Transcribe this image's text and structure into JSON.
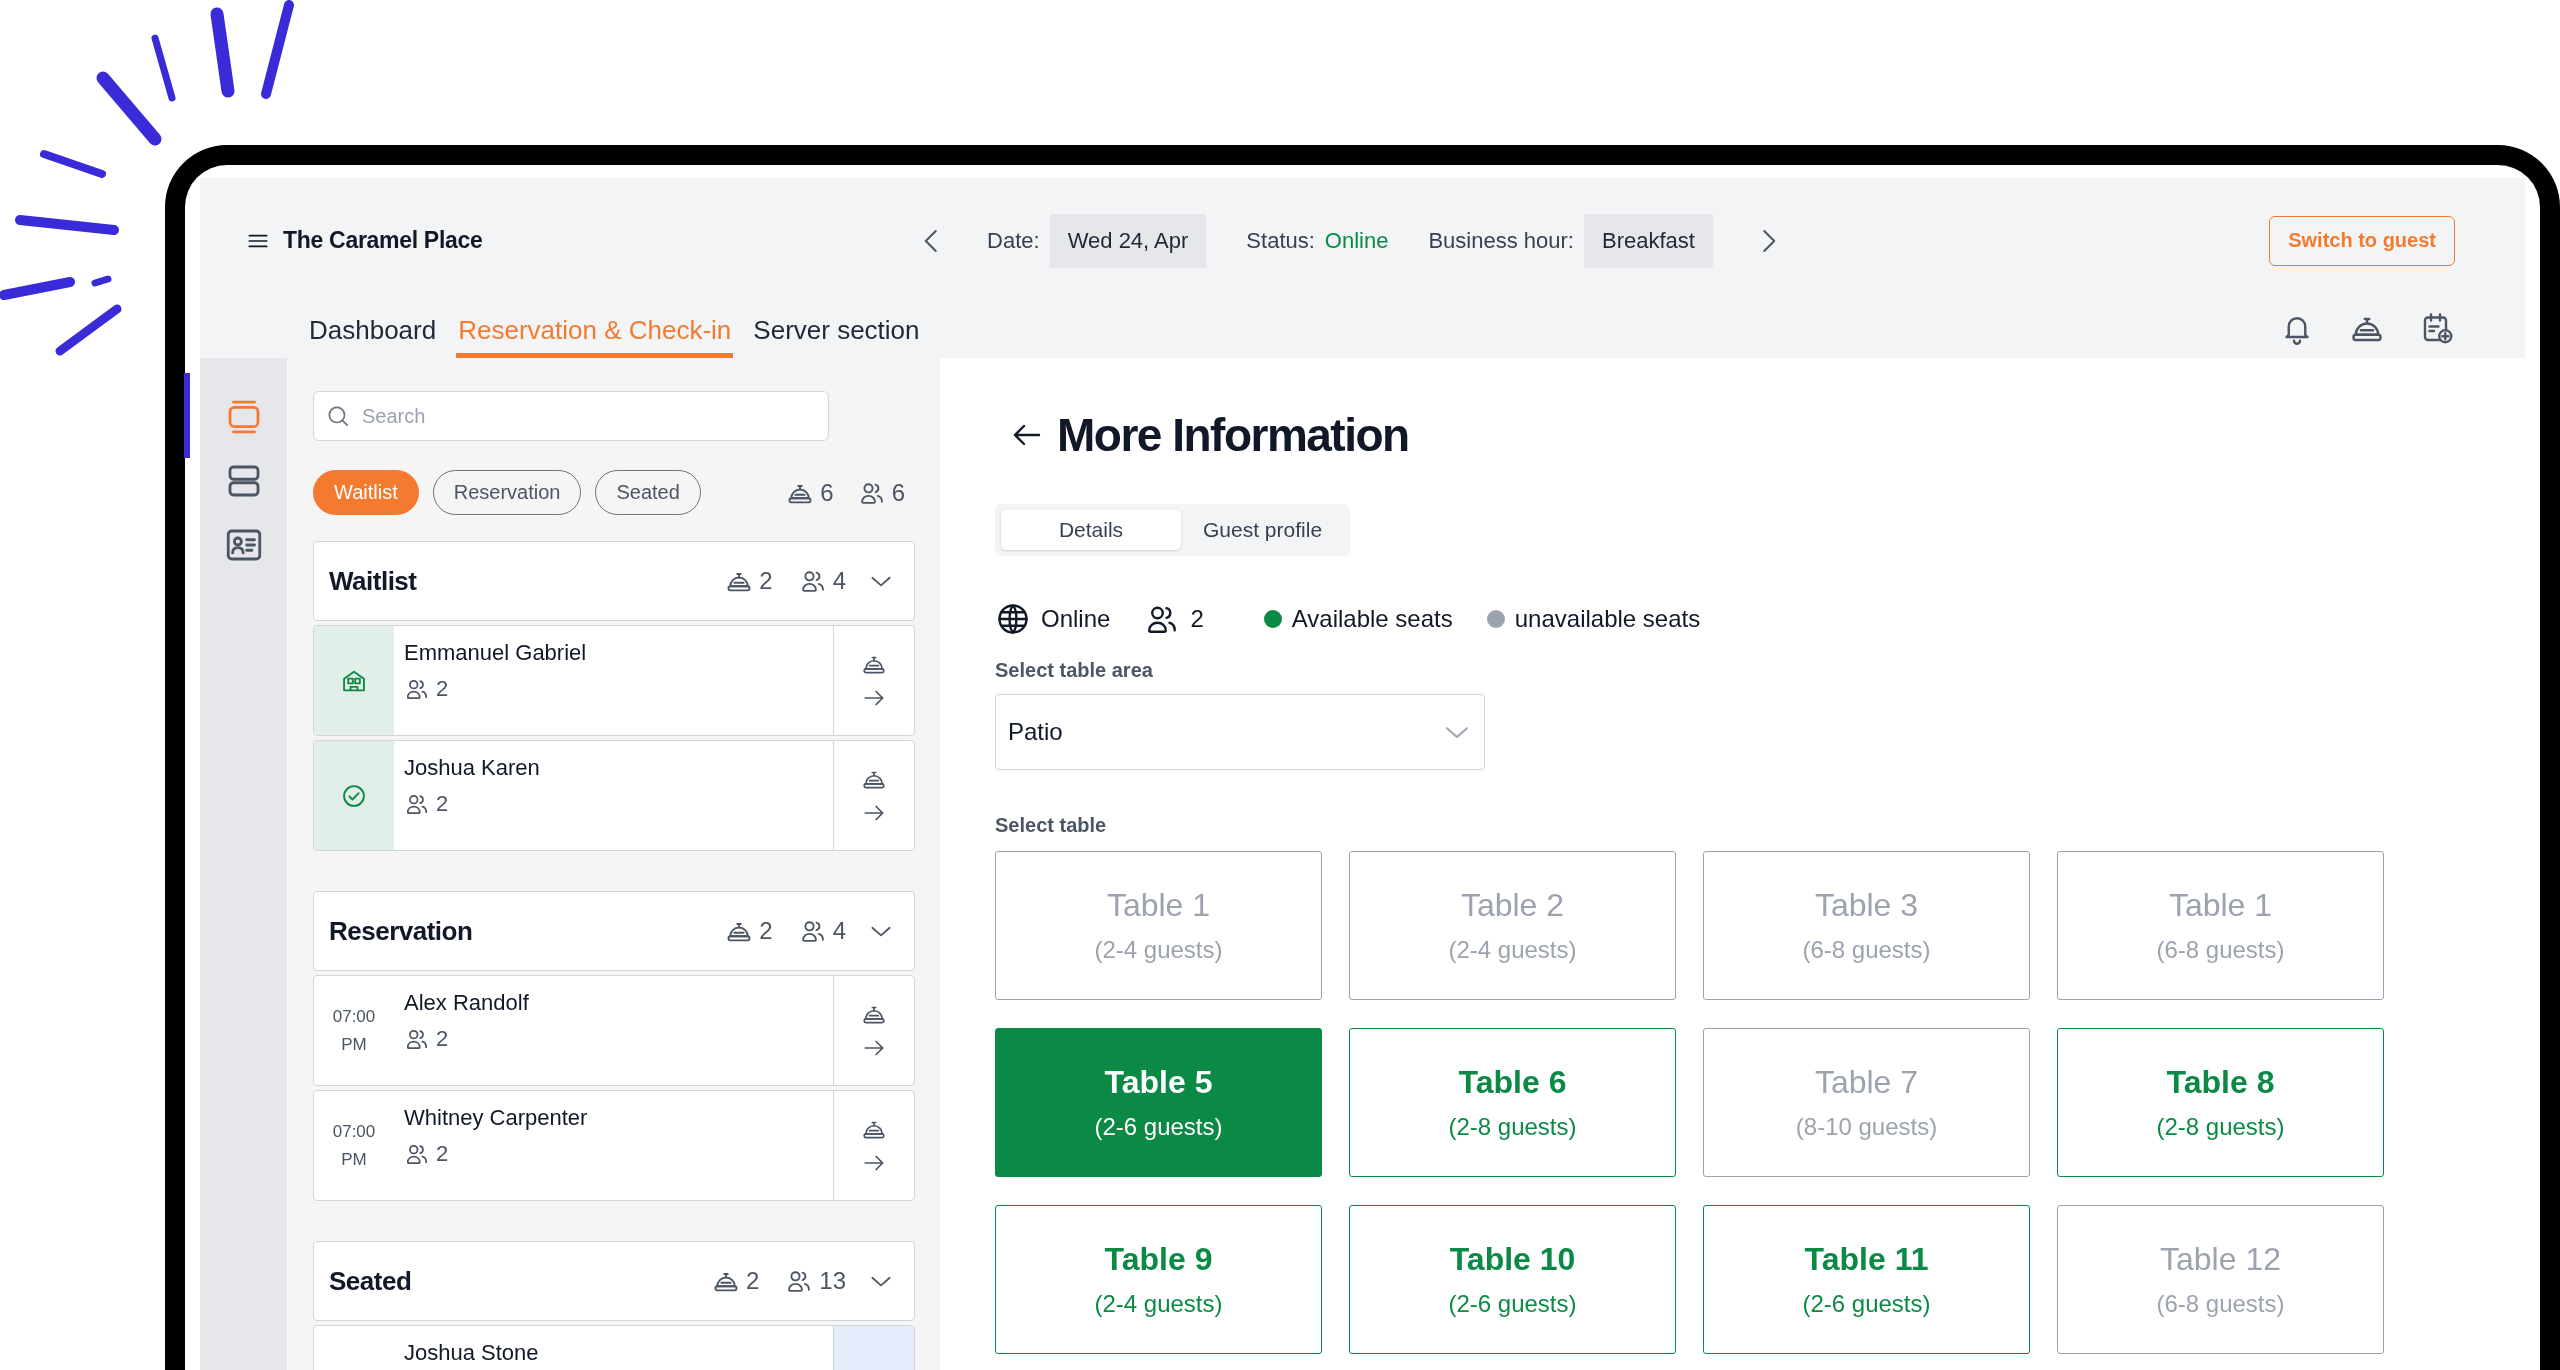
{
  "header": {
    "title": "The Caramel Place",
    "date_label": "Date:",
    "date": "Wed 24, Apr",
    "status_label": "Status:",
    "status": "Online",
    "business_hour_label": "Business hour:",
    "business_hour": "Breakfast",
    "switch_button": "Switch to guest"
  },
  "nav_tabs": [
    {
      "label": "Dashboard",
      "selected": false
    },
    {
      "label": "Reservation & Check-in",
      "selected": true
    },
    {
      "label": "Server section",
      "selected": false
    }
  ],
  "rail": [
    {
      "kind": "cards",
      "selected": true
    },
    {
      "kind": "rows",
      "selected": false
    },
    {
      "kind": "contact",
      "selected": false
    }
  ],
  "queue": {
    "search_placeholder": "Search",
    "filters": [
      {
        "label": "Waitlist",
        "selected": true
      },
      {
        "label": "Reservation",
        "selected": false
      },
      {
        "label": "Seated",
        "selected": false
      }
    ],
    "total_tables": "6",
    "total_guests": "6",
    "groups": [
      {
        "title": "Waitlist",
        "tables": "2",
        "guests": "4",
        "expanded": true,
        "entries": [
          {
            "kind": "house",
            "name": "Emmanuel Gabriel",
            "guests": "2",
            "highlighted": false
          },
          {
            "kind": "check",
            "name": "Joshua Karen",
            "guests": "2",
            "highlighted": false
          }
        ]
      },
      {
        "title": "Reservation",
        "tables": "2",
        "guests": "4",
        "expanded": true,
        "entries": [
          {
            "kind": "time",
            "time": "07:00",
            "period": "PM",
            "name": "Alex Randolf",
            "guests": "2",
            "highlighted": false
          },
          {
            "kind": "time",
            "time": "07:00",
            "period": "PM",
            "name": "Whitney Carpenter",
            "guests": "2",
            "highlighted": false
          }
        ]
      },
      {
        "title": "Seated",
        "tables": "2",
        "guests": "13",
        "expanded": true,
        "entries": [
          {
            "kind": "blank",
            "name": "Joshua Stone",
            "highlighted": true
          }
        ]
      }
    ]
  },
  "detail": {
    "title": "More Information",
    "tabs": [
      {
        "label": "Details",
        "selected": true
      },
      {
        "label": "Guest profile",
        "selected": false
      }
    ],
    "channel": "Online",
    "party_size": "2",
    "legend": [
      {
        "label": "Available seats",
        "color": "#0b8a45"
      },
      {
        "label": "unavailable seats",
        "color": "#9ca3af"
      }
    ],
    "area_label": "Select table area",
    "area_value": "Patio",
    "table_label": "Select table",
    "tables": [
      {
        "name": "Table 1",
        "capacity": "(2-4 guests)",
        "available": false,
        "selected": false
      },
      {
        "name": "Table 2",
        "capacity": "(2-4 guests)",
        "available": false,
        "selected": false
      },
      {
        "name": "Table 3",
        "capacity": "(6-8 guests)",
        "available": false,
        "selected": false
      },
      {
        "name": "Table 1",
        "capacity": "(6-8 guests)",
        "available": false,
        "selected": false
      },
      {
        "name": "Table 5",
        "capacity": "(2-6 guests)",
        "available": true,
        "selected": true
      },
      {
        "name": "Table 6",
        "capacity": "(2-8 guests)",
        "available": true,
        "selected": false
      },
      {
        "name": "Table 7",
        "capacity": "(8-10 guests)",
        "available": false,
        "selected": false
      },
      {
        "name": "Table 8",
        "capacity": "(2-8 guests)",
        "available": true,
        "selected": false
      },
      {
        "name": "Table 9",
        "capacity": "(2-4 guests)",
        "available": true,
        "selected": false
      },
      {
        "name": "Table 10",
        "capacity": "(2-6 guests)",
        "available": true,
        "selected": false
      },
      {
        "name": "Table 11",
        "capacity": "(2-6 guests)",
        "available": true,
        "selected": false
      },
      {
        "name": "Table 12",
        "capacity": "(6-8 guests)",
        "available": false,
        "selected": false
      }
    ]
  }
}
